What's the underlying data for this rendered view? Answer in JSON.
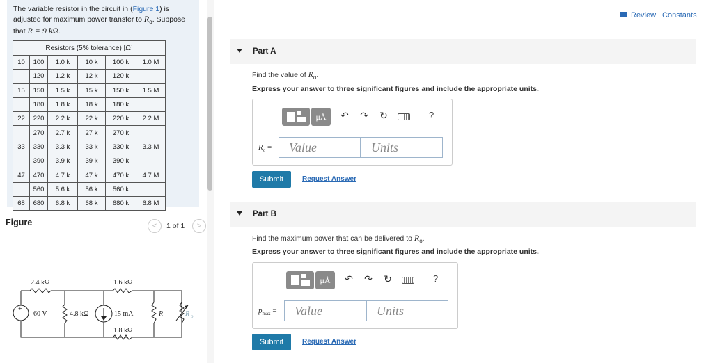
{
  "problem": {
    "text_before": "The variable resistor in the circuit in (",
    "figure_link": "Figure 1",
    "text_after": ") is adjusted for maximum power transfer to ",
    "ro": "R",
    "ro_sub": "o",
    "text_suppose": ". Suppose that ",
    "r_eq": "R = 9  kΩ",
    "end": "."
  },
  "table": {
    "header": "Resistors (5% tolerance) [Ω]",
    "rows": [
      [
        "10",
        "100",
        "1.0 k",
        "10 k",
        "100 k",
        "1.0 M"
      ],
      [
        "",
        "120",
        "1.2 k",
        "12 k",
        "120 k",
        ""
      ],
      [
        "15",
        "150",
        "1.5 k",
        "15 k",
        "150 k",
        "1.5 M"
      ],
      [
        "",
        "180",
        "1.8 k",
        "18 k",
        "180 k",
        ""
      ],
      [
        "22",
        "220",
        "2.2 k",
        "22 k",
        "220 k",
        "2.2 M"
      ],
      [
        "",
        "270",
        "2.7 k",
        "27 k",
        "270 k",
        ""
      ],
      [
        "33",
        "330",
        "3.3 k",
        "33 k",
        "330 k",
        "3.3 M"
      ],
      [
        "",
        "390",
        "3.9 k",
        "39 k",
        "390 k",
        ""
      ],
      [
        "47",
        "470",
        "4.7 k",
        "47 k",
        "470 k",
        "4.7 M"
      ],
      [
        "",
        "560",
        "5.6 k",
        "56 k",
        "560 k",
        ""
      ],
      [
        "68",
        "680",
        "6.8 k",
        "68 k",
        "680 k",
        "6.8 M"
      ]
    ]
  },
  "figure": {
    "label": "Figure",
    "page": "1 of 1",
    "prev": "<",
    "next": ">",
    "circuit": {
      "r1": "2.4 kΩ",
      "r2": "1.6 kΩ",
      "r3": "1.8 kΩ",
      "v": "60 V",
      "r4": "4.8 kΩ",
      "i": "15 mA",
      "r": "R",
      "ro": "R",
      "ro_sub": "o",
      "plus": "+"
    }
  },
  "header": {
    "review": "Review | Constants"
  },
  "partA": {
    "title": "Part A",
    "question": "Find the value of ",
    "q_var": "R",
    "q_sub": "o",
    "q_end": ".",
    "instruction": "Express your answer to three significant figures and include the appropriate units.",
    "var": "R",
    "var_sub": "o",
    "eq": " =",
    "value_placeholder": "Value",
    "units_placeholder": "Units",
    "submit": "Submit",
    "request": "Request Answer"
  },
  "partB": {
    "title": "Part B",
    "question": "Find the maximum power that can be delivered to ",
    "q_var": "R",
    "q_sub": "o",
    "q_end": ".",
    "instruction": "Express your answer to three significant figures and include the appropriate units.",
    "var": "p",
    "var_sub": "max",
    "eq": " =",
    "value_placeholder": "Value",
    "units_placeholder": "Units",
    "submit": "Submit",
    "request": "Request Answer"
  },
  "toolbar": {
    "mu": "μÅ",
    "undo": "↶",
    "redo": "↷",
    "reset": "↻",
    "help": "?"
  }
}
